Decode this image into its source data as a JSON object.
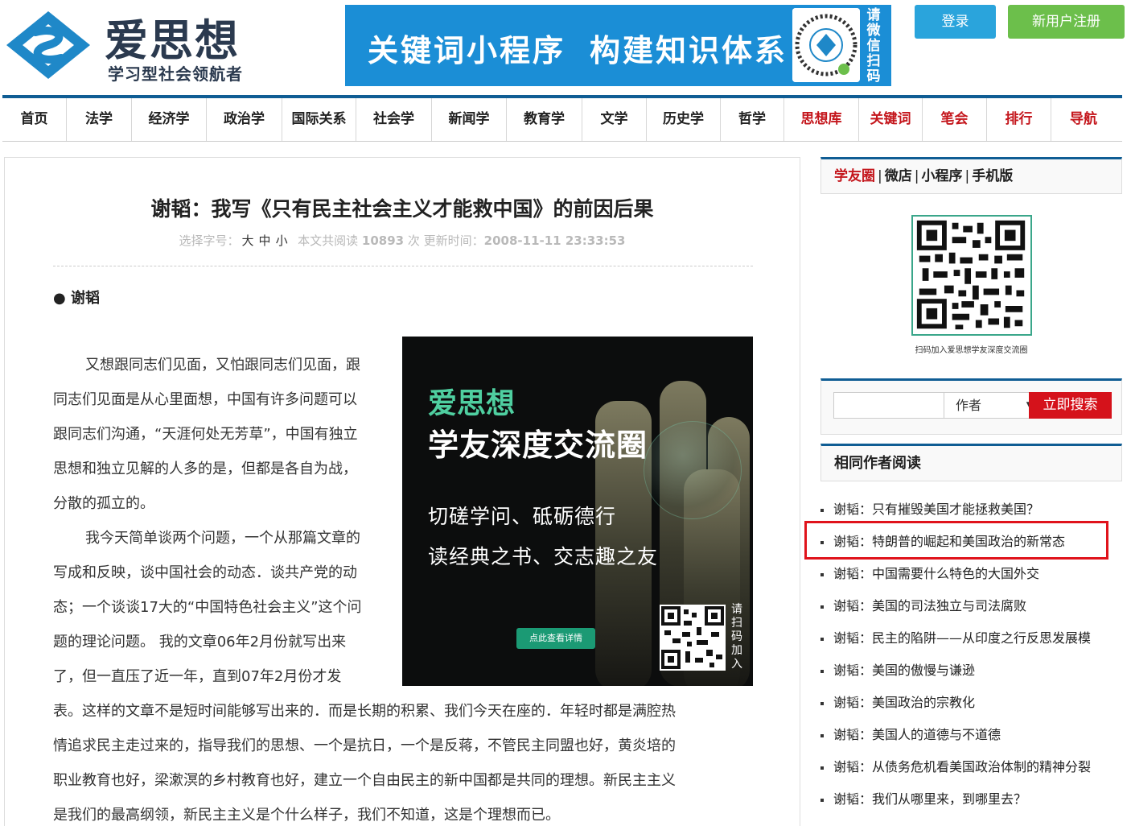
{
  "header": {
    "logo_title": "爱思想",
    "logo_subtitle": "学习型社会领航者",
    "banner_text_1": "关键词小程序",
    "banner_text_2": "构建知识体系",
    "banner_qr_label": "请微信扫码",
    "login_label": "登录",
    "register_label": "新用户注册"
  },
  "nav": {
    "items": [
      {
        "label": "首页",
        "w": 80
      },
      {
        "label": "法学",
        "w": 81
      },
      {
        "label": "经济学",
        "w": 93
      },
      {
        "label": "政治学",
        "w": 94
      },
      {
        "label": "国际关系",
        "w": 92
      },
      {
        "label": "社会学",
        "w": 94
      },
      {
        "label": "新闻学",
        "w": 93
      },
      {
        "label": "教育学",
        "w": 94
      },
      {
        "label": "文学",
        "w": 80
      },
      {
        "label": "历史学",
        "w": 92
      },
      {
        "label": "哲学",
        "w": 79
      },
      {
        "label": "思想库",
        "w": 93
      },
      {
        "label": "关键词",
        "w": 79
      },
      {
        "label": "笔会",
        "w": 80
      },
      {
        "label": "排行",
        "w": 80
      },
      {
        "label": "导航",
        "w": 80
      }
    ]
  },
  "colors": {
    "nav_border": "#0f5d94",
    "accent_red": "#c4161c",
    "login_blue": "#2aa4dc",
    "register_green": "#6cbf4b",
    "search_red": "#d5121b"
  },
  "article": {
    "title": "谢韬：我写《只有民主社会主义才能救中国》的前因后果",
    "meta_prefix": "选择字号：",
    "size_large": "大",
    "size_medium": "中",
    "size_small": "小",
    "read_prefix": "本文共阅读",
    "read_count": "10893",
    "read_suffix": "次 更新时间：",
    "updated": "2008-11-11 23:33:53",
    "author": "● 谢韬",
    "paragraphs": {
      "p1_l1": "又想跟同志们见面，又怕跟同志们见面，跟",
      "p1_l2": "同志们见面是从心里面想，中国有许多问题可以",
      "p1_l3": "跟同志们沟通，“天涯何处无芳草”，中国有独立",
      "p1_l4": "思想和独立见解的人多的是，但都是各自为战，",
      "p1_l5": "分散的孤立的。",
      "p2_l1": "我今天简单谈两个问题，一个从那篇文章的",
      "p2_l2": "写成和反映，谈中国社会的动态．谈共产党的动",
      "p2_l3": "态；一个谈谈17大的“中国特色社会主义”这个问",
      "p2_l4": "题的理论问题。 我的文章06年2月份就写出来",
      "p2_l5": "了，但一直压了近一年，直到07年2月份才发",
      "p2_l6": "表。这样的文章不是短时间能够写出来的．而是长期的积累、我们今天在座的．年轻时都是满腔热",
      "p2_l7": "情追求民主走过来的，指导我们的思想、一个是抗日，一个是反蒋，不管民主同盟也好，黄炎培的",
      "p2_l8": "职业教育也好，梁漱溟的乡村教育也好，建立一个自由民主的新中国都是共同的理想。新民主主义",
      "p2_l9": "是我们的最高纲领，新民主主义是个什么样子，我们不知道，这是个理想而已。"
    }
  },
  "ad": {
    "title_1": "爱思想",
    "title_2": "学友深度交流圈",
    "line_1": "切磋学问、砥砺德行",
    "line_2": "读经典之书、交志趣之友",
    "button": "点此查看详情",
    "qr_label": "请扫码加入"
  },
  "sidebar": {
    "tab_active": "学友圈",
    "tab_2": "微店",
    "tab_3": "小程序",
    "tab_4": "手机版",
    "qr_caption": "扫码加入爱思想学友深度交流圈",
    "search_value": "",
    "search_select": "作者",
    "search_button": "立即搜索",
    "same_author_heading": "相同作者阅读",
    "related": [
      "谢韬：只有摧毁美国才能拯救美国？",
      "谢韬：特朗普的崛起和美国政治的新常态",
      "谢韬：中国需要什么特色的大国外交",
      "谢韬：美国的司法独立与司法腐败",
      "谢韬：民主的陷阱——从印度之行反思发展模",
      "谢韬：美国的傲慢与谦逊",
      "谢韬：美国政治的宗教化",
      "谢韬：美国人的道德与不道德",
      "谢韬：从债务危机看美国政治体制的精神分裂",
      "谢韬：我们从哪里来，到哪里去？"
    ]
  }
}
